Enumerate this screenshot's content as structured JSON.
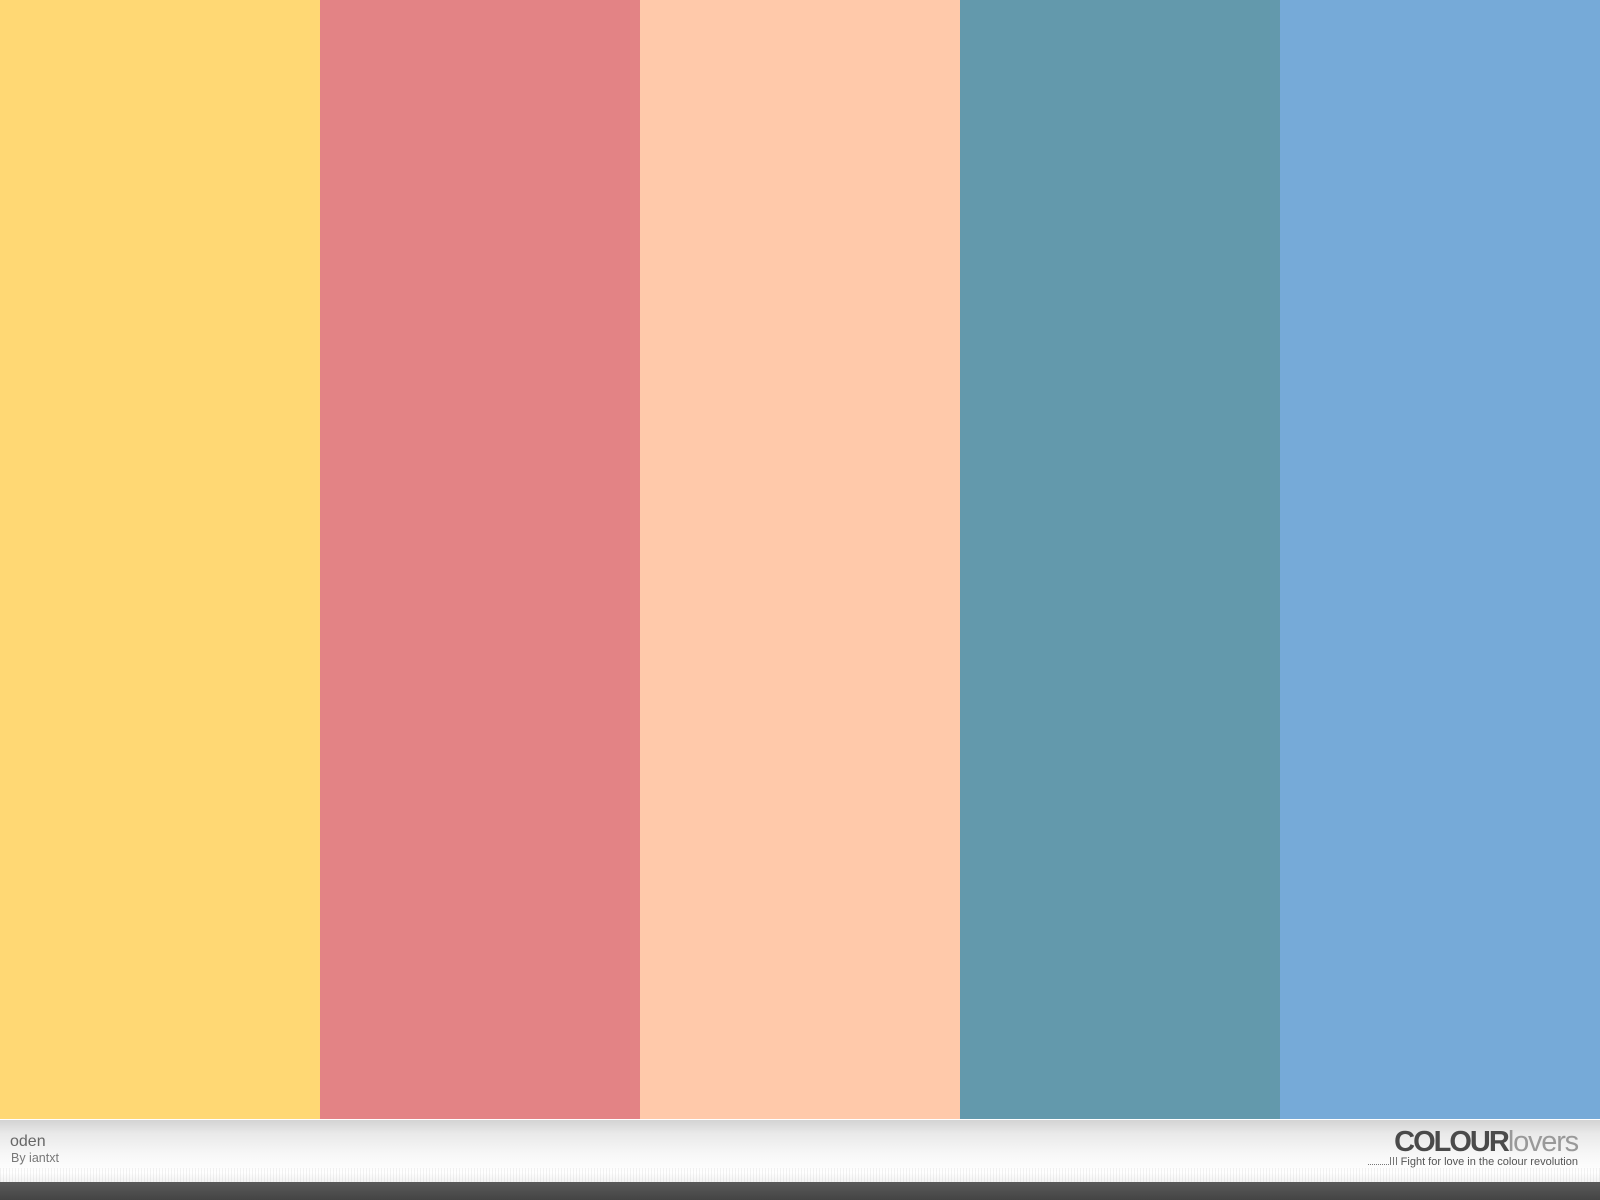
{
  "palette": {
    "title": "oden",
    "author": "By iantxt",
    "colors": [
      {
        "hex": "#FFD874",
        "share": 0.2
      },
      {
        "hex": "#E38385",
        "share": 0.2
      },
      {
        "hex": "#FFC9AA",
        "share": 0.2
      },
      {
        "hex": "#6399AC",
        "share": 0.2
      },
      {
        "hex": "#76AAD8",
        "share": 0.2
      }
    ]
  },
  "brand": {
    "logo_strong": "COLOUR",
    "logo_light": "lovers",
    "tagline": "Fight for love in the colour revolution",
    "tagline_icon": "dotted-line-icon"
  }
}
